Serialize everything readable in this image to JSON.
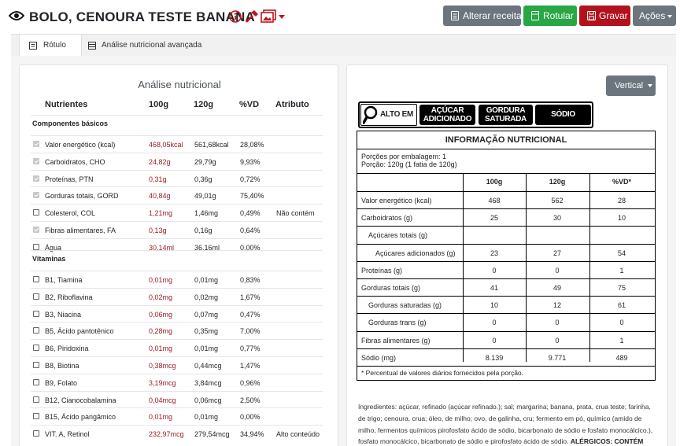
{
  "header": {
    "title": "BOLO, CENOURA TESTE BANANA",
    "buttons": {
      "alterar": "Alterar receita",
      "rotular": "Rotular",
      "gravar": "Gravar",
      "acoes": "Ações"
    },
    "colors": {
      "alterar": "#6c757d",
      "rotular": "#28a745",
      "gravar": "#b3121d",
      "acoes": "#6c757d",
      "accent": "#c0151c"
    }
  },
  "tabs": [
    {
      "label": "Rótulo",
      "active": true
    },
    {
      "label": "Análise nutricional avançada",
      "active": false
    }
  ],
  "analysis": {
    "title": "Análise nutricional",
    "columns": [
      "Nutrientes",
      "100g",
      "120g",
      "%VD",
      "Atributo"
    ],
    "sections": [
      {
        "name": "Componentes básicos",
        "rows": [
          {
            "checked": true,
            "disabled": true,
            "name": "Valor energético (kcal)",
            "v100": "468,05kcal",
            "v120": "561,68kcal",
            "vd": "28,08%",
            "attr": ""
          },
          {
            "checked": true,
            "disabled": true,
            "name": "Carboidratos, CHO",
            "v100": "24,82g",
            "v120": "29,79g",
            "vd": "9,93%",
            "attr": ""
          },
          {
            "checked": true,
            "disabled": true,
            "name": "Proteínas, PTN",
            "v100": "0,31g",
            "v120": "0,36g",
            "vd": "0,72%",
            "attr": ""
          },
          {
            "checked": true,
            "disabled": true,
            "name": "Gorduras totais, GORD",
            "v100": "40,84g",
            "v120": "49,01g",
            "vd": "75,40%",
            "attr": ""
          },
          {
            "checked": false,
            "disabled": false,
            "name": "Colesterol, COL",
            "v100": "1,21mg",
            "v120": "1,46mg",
            "vd": "0,49%",
            "attr": "Não contém"
          },
          {
            "checked": true,
            "disabled": true,
            "name": "Fibras alimentares, FA",
            "v100": "0,13g",
            "v120": "0,16g",
            "vd": "0,64%",
            "attr": ""
          },
          {
            "checked": false,
            "disabled": false,
            "name": "Água",
            "v100": "30,14ml",
            "v120": "36,16ml",
            "vd": "0,00%",
            "attr": ""
          }
        ]
      },
      {
        "name": "Vitaminas",
        "rows": [
          {
            "checked": false,
            "disabled": false,
            "name": "B1, Tiamina",
            "v100": "0,01mg",
            "v120": "0,01mg",
            "vd": "0,83%",
            "attr": ""
          },
          {
            "checked": false,
            "disabled": false,
            "name": "B2, Riboflavina",
            "v100": "0,02mg",
            "v120": "0,02mg",
            "vd": "1,67%",
            "attr": ""
          },
          {
            "checked": false,
            "disabled": false,
            "name": "B3, Niacina",
            "v100": "0,06mg",
            "v120": "0,07mg",
            "vd": "0,47%",
            "attr": ""
          },
          {
            "checked": false,
            "disabled": false,
            "name": "B5, Ácido pantotênico",
            "v100": "0,28mg",
            "v120": "0,35mg",
            "vd": "7,00%",
            "attr": ""
          },
          {
            "checked": false,
            "disabled": false,
            "name": "B6, Piridoxina",
            "v100": "0,01mg",
            "v120": "0,01mg",
            "vd": "0,77%",
            "attr": ""
          },
          {
            "checked": false,
            "disabled": false,
            "name": "B8, Biotina",
            "v100": "0,38mcg",
            "v120": "0,44mcg",
            "vd": "1,47%",
            "attr": ""
          },
          {
            "checked": false,
            "disabled": false,
            "name": "B9, Folato",
            "v100": "3,19mcg",
            "v120": "3,84mcg",
            "vd": "0,96%",
            "attr": ""
          },
          {
            "checked": false,
            "disabled": false,
            "name": "B12, Cianocobalamina",
            "v100": "0,04mcg",
            "v120": "0,06mcg",
            "vd": "2,50%",
            "attr": ""
          },
          {
            "checked": false,
            "disabled": false,
            "name": "B15, Ácido pangâmico",
            "v100": "0,01mg",
            "v120": "0,01mg",
            "vd": "0,00%",
            "attr": ""
          },
          {
            "checked": false,
            "disabled": false,
            "name": "VIT. A, Retinol",
            "v100": "232,97mcg",
            "v120": "279,54mcg",
            "vd": "34,94%",
            "attr": "Alto conteúdo"
          }
        ]
      }
    ]
  },
  "label": {
    "layout_button": "Vertical",
    "warning": {
      "alto_em": "ALTO EM",
      "acucar_line1": "AÇÚCAR",
      "acucar_line2": "ADICIONADO",
      "gordura_line1": "GORDURA",
      "gordura_line2": "SATURADA",
      "sodio": "SÓDIO"
    },
    "table": {
      "title": "INFORMAÇÃO NUTRICIONAL",
      "portions_line1": "Porções por embalagem: 1",
      "portions_line2": "Porção: 120g (1 fatia de 120g)",
      "headers": [
        "100g",
        "120g",
        "%VD*"
      ],
      "rows": [
        {
          "name": "Valor energético (kcal)",
          "indent": 0,
          "v100": "468",
          "v120": "562",
          "vd": "28"
        },
        {
          "name": "Carboidratos (g)",
          "indent": 0,
          "v100": "25",
          "v120": "30",
          "vd": "10"
        },
        {
          "name": "Açúcares totais (g)",
          "indent": 1,
          "v100": "",
          "v120": "",
          "vd": ""
        },
        {
          "name": "Açúcares adicionados (g)",
          "indent": 2,
          "v100": "23",
          "v120": "27",
          "vd": "54"
        },
        {
          "name": "Proteínas (g)",
          "indent": 0,
          "v100": "0",
          "v120": "0",
          "vd": "1"
        },
        {
          "name": "Gorduras totais (g)",
          "indent": 0,
          "v100": "41",
          "v120": "49",
          "vd": "75"
        },
        {
          "name": "Gorduras saturadas (g)",
          "indent": 1,
          "v100": "10",
          "v120": "12",
          "vd": "61"
        },
        {
          "name": "Gorduras trans (g)",
          "indent": 1,
          "v100": "0",
          "v120": "0",
          "vd": "0"
        },
        {
          "name": "Fibras alimentares (g)",
          "indent": 0,
          "v100": "0",
          "v120": "0",
          "vd": "1"
        },
        {
          "name": "Sódio (mg)",
          "indent": 0,
          "v100": "8.139",
          "v120": "9.771",
          "vd": "489"
        }
      ],
      "footnote": "* Percentual de valores diários fornecidos pela porção."
    },
    "ingredients": "Ingredientes: açúcar, refinado (açúcar refinado.); sal; margarina; banana, prata, crua teste; farinha, de trigo; cenoura, crua; óleo, de milho; ovo, de galinha, cru; fermento em pó, químico (amido de milho, fermentos químicos pirofosfato ácido de sódio, bicarbonato de sódio e fosfato monocálcico.), fosfato monocálcico, bicarbonato de sódio e pirofosfato ácido de sódio.",
    "allergens_lead": "ALÉRGICOS: CONTÉM"
  }
}
